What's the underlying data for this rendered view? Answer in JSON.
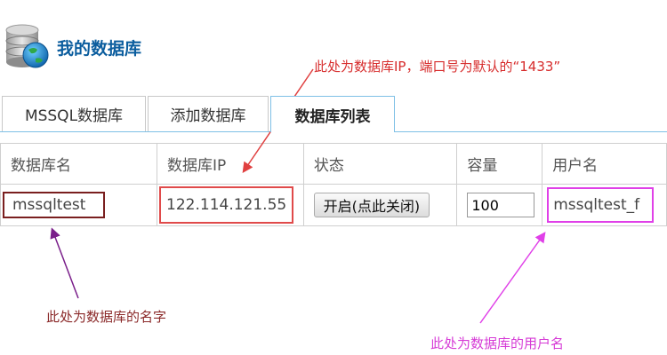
{
  "header": {
    "title": "我的数据库",
    "icon": "database-globe-icon"
  },
  "annotations": {
    "ip_note": "此处为数据库IP，端口号为默认的“1433”",
    "name_note": "此处为数据库的名字",
    "user_note": "此处为数据库的用户名"
  },
  "tabs": [
    {
      "label": "MSSQL数据库"
    },
    {
      "label": "添加数据库"
    },
    {
      "label": "数据库列表",
      "active": true
    }
  ],
  "table": {
    "headers": [
      "数据库名",
      "数据库IP",
      "状态",
      "容量",
      "用户名"
    ],
    "row": {
      "name": "mssqltest",
      "ip": "122.114.121.55",
      "state_button": "开启(点此关闭)",
      "capacity": "100",
      "user": "mssqltest_f"
    }
  },
  "colors": {
    "title": "#0b5d9e",
    "tab_accent": "#7fc0e6",
    "ip_note": "#d72d2d",
    "name_box": "#7a1f1f",
    "user_note": "#d63bd6"
  }
}
